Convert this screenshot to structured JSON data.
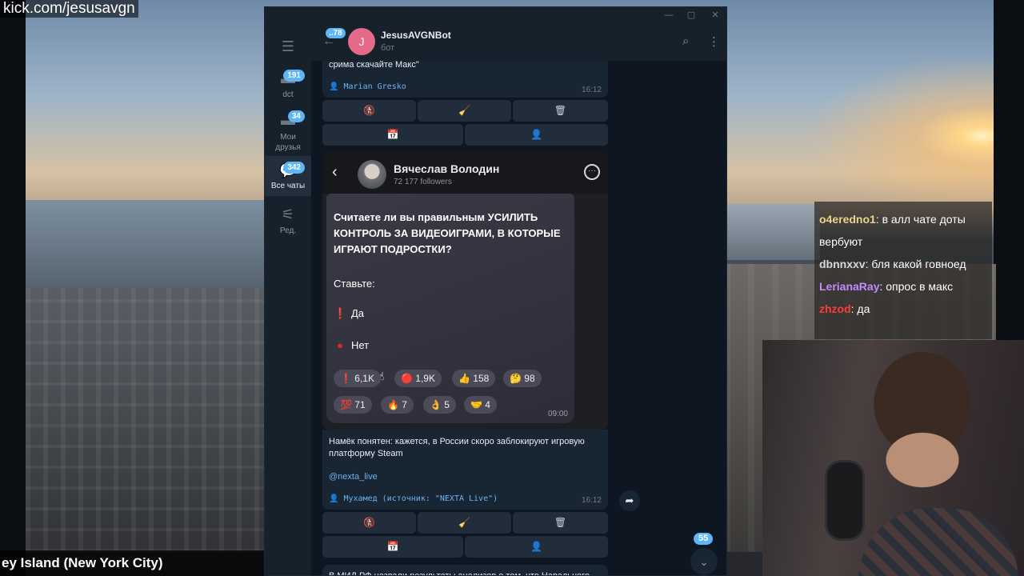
{
  "stream": {
    "url": "kick.com/jesusavgn",
    "caption": "ey Island (New York City)",
    "chat": [
      {
        "user": "o4eredno1",
        "text": ": в алл чате доты вербуют",
        "color": "#e8d48a"
      },
      {
        "user": "dbnnxxv",
        "text": ": бля какой говноед",
        "color": "#d8d8d8"
      },
      {
        "user": "LerianaRay",
        "text": ": опрос в макс",
        "color": "#c48aff"
      },
      {
        "user": "zhzod",
        "text": ": да",
        "color": "#ff3b3b"
      }
    ]
  },
  "telegram": {
    "rail": [
      {
        "label": "dct",
        "badge": "191",
        "icon": "chat-bubble-icon"
      },
      {
        "label": "Мои друзья",
        "badge": "34",
        "icon": "chat-bubble-icon"
      },
      {
        "label": "Все чаты",
        "badge": "342",
        "icon": "chats-icon"
      },
      {
        "label": "Ред.",
        "badge": "",
        "icon": "sliders-icon"
      }
    ],
    "header": {
      "back_badge": "..78",
      "avatar_letter": "J",
      "name": "JesusAVGNBot",
      "status": "бот"
    },
    "messages": {
      "first": {
        "text": "срима скачайте  Макс\"",
        "sign": "Marian Gresko",
        "time": "16:12"
      },
      "second": {
        "text": "Намёк понятен: кажется, в России скоро заблокируют игровую платформу Steam",
        "link": "@nexta_live",
        "sign": "Мухамед (источник: \"NEXTA Live\")",
        "time": "16:12"
      },
      "third": {
        "text": "В МИД РФ назвали результаты анализов о том, что Навального"
      }
    },
    "keyboard": [
      "🚷",
      "🧹",
      "🗑",
      "📅",
      "👤"
    ],
    "embed": {
      "name": "Вячеслав Володин",
      "followers": "72 177 followers",
      "question": "Считаете ли вы правильным УСИЛИТЬ КОНТРОЛЬ ЗА ВИДЕОИГРАМИ, В КОТОРЫЕ ИГРАЮТ ПОДРОСТКИ?",
      "vote_prompt": "Ставьте:",
      "option_yes": "Да",
      "option_no": "Нет",
      "reactions_row1": [
        {
          "icon": "❗",
          "count": "6,1K"
        },
        {
          "icon": "🔴",
          "count": "1,9K"
        },
        {
          "icon": "👍",
          "count": "158"
        },
        {
          "icon": "🤔",
          "count": "98"
        }
      ],
      "reactions_row2": [
        {
          "icon": "💯",
          "count": "71"
        },
        {
          "icon": "🔥",
          "count": "7"
        },
        {
          "icon": "👌",
          "count": "5"
        },
        {
          "icon": "🤝",
          "count": "4"
        }
      ],
      "time": "09:00"
    },
    "scroll_badge": "55"
  }
}
